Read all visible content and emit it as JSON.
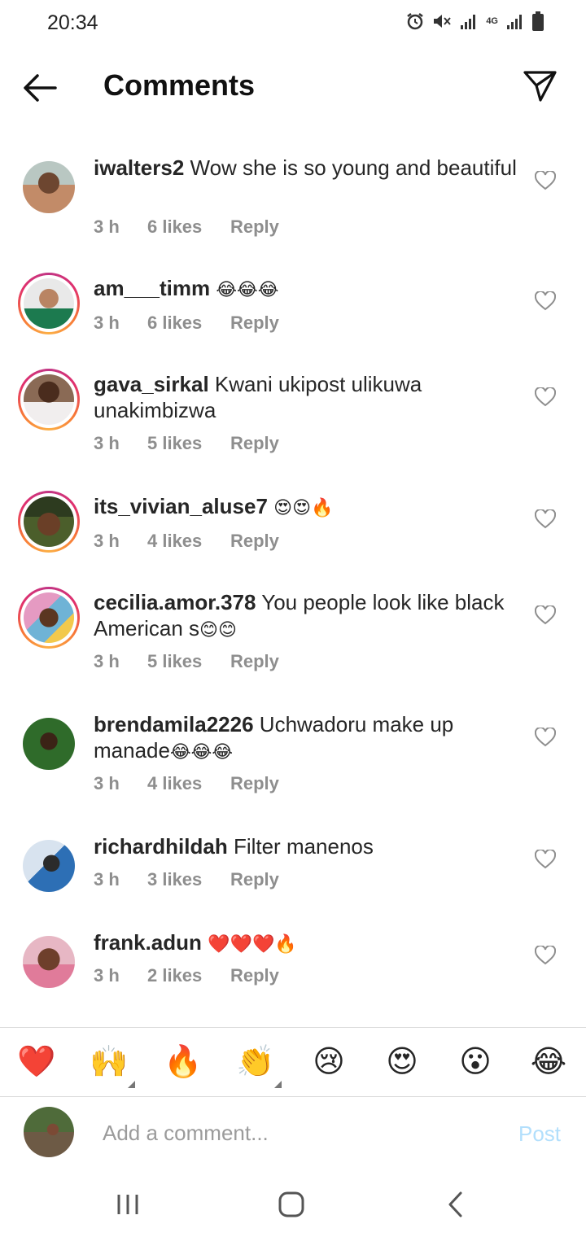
{
  "status_bar": {
    "time": "20:34",
    "icons": [
      "alarm-icon",
      "mute-icon",
      "signal-icon",
      "4g-icon",
      "signal-icon",
      "battery-icon"
    ],
    "network_label": "4G"
  },
  "header": {
    "title": "Comments",
    "back_icon": "arrow-left-icon",
    "share_icon": "paper-plane-icon"
  },
  "comments": [
    {
      "username": "iwalters2",
      "text": "Wow she is so young and beautiful",
      "emoji": "",
      "time": "3 h",
      "likes": "6 likes",
      "reply": "Reply",
      "has_story_ring": false
    },
    {
      "username": "am___timm",
      "text": "",
      "emoji": "😂😂😂",
      "time": "3 h",
      "likes": "6 likes",
      "reply": "Reply",
      "has_story_ring": true
    },
    {
      "username": "gava_sirkal",
      "text": "Kwani ukipost ulikuwa unakimbizwa",
      "emoji": "",
      "time": "3 h",
      "likes": "5 likes",
      "reply": "Reply",
      "has_story_ring": true
    },
    {
      "username": "its_vivian_aluse7",
      "text": "",
      "emoji": "😍😍🔥",
      "time": "3 h",
      "likes": "4 likes",
      "reply": "Reply",
      "has_story_ring": true
    },
    {
      "username": "cecilia.amor.378",
      "text": "You people look like black American s",
      "emoji": "😊😊",
      "time": "3 h",
      "likes": "5 likes",
      "reply": "Reply",
      "has_story_ring": true
    },
    {
      "username": "brendamila2226",
      "text": "Uchwadoru make up manade",
      "emoji": "😂😂😂",
      "time": "3 h",
      "likes": "4 likes",
      "reply": "Reply",
      "has_story_ring": false
    },
    {
      "username": "richardhildah",
      "text": "Filter manenos",
      "emoji": "",
      "time": "3 h",
      "likes": "3 likes",
      "reply": "Reply",
      "has_story_ring": false
    },
    {
      "username": "frank.adun",
      "text": "",
      "emoji": "❤️❤️❤️🔥",
      "time": "3 h",
      "likes": "2 likes",
      "reply": "Reply",
      "has_story_ring": false
    }
  ],
  "like_icon": "heart-outline-icon",
  "reactions": [
    {
      "emoji": "❤️",
      "name": "red-heart"
    },
    {
      "emoji": "🙌",
      "name": "raising-hands",
      "has_variants": true
    },
    {
      "emoji": "🔥",
      "name": "fire"
    },
    {
      "emoji": "👏",
      "name": "clapping-hands",
      "has_variants": true
    },
    {
      "emoji": "😢",
      "name": "crying-face"
    },
    {
      "emoji": "😍",
      "name": "heart-eyes"
    },
    {
      "emoji": "😮",
      "name": "surprised-face"
    },
    {
      "emoji": "😂",
      "name": "tears-of-joy"
    }
  ],
  "composer": {
    "placeholder": "Add a comment...",
    "post_label": "Post"
  },
  "nav_bar": {
    "icons": [
      "recent-apps-icon",
      "home-icon",
      "back-nav-icon"
    ]
  },
  "colors": {
    "post_disabled": "#b2dffc",
    "meta_gray": "#8e8e8e",
    "story_ring": "#e1306c"
  }
}
